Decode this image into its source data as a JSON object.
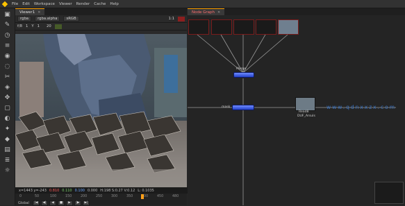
{
  "menubar": {
    "items": [
      "File",
      "Edit",
      "Workspace",
      "Viewer",
      "Render",
      "Cache",
      "Help"
    ]
  },
  "viewer": {
    "tab_label": "Viewer1",
    "layer": "rgba",
    "channel": "rgba.alpha",
    "view": "sRGB",
    "frame_label": "1:1",
    "gain_label": "f/8",
    "gain_value": "1",
    "gamma_label": "Y",
    "gamma_value": "1",
    "zoom_value": "20",
    "info": {
      "coords": "x=1443 y=-243",
      "r": "0.810",
      "g": "0.110",
      "b": "0.100",
      "a": "0.000",
      "hsv": "H:198 S:0.27 V:0.12",
      "l": "L: 0.1035"
    },
    "timeline": {
      "ticks": [
        "0",
        "50",
        "100",
        "150",
        "200",
        "250",
        "300",
        "350",
        "400",
        "450",
        "480"
      ],
      "playhead_frame": 400,
      "global_label": "Global"
    }
  },
  "nodegraph": {
    "tab_label": "Node Graph",
    "watermark": "www.qdnxxzx.com",
    "merge_label": "Merge",
    "mask_label": "mask",
    "read_label": "Read8",
    "read_sub": "DUF_Arsuls",
    "accent_color": "#ffa000"
  }
}
